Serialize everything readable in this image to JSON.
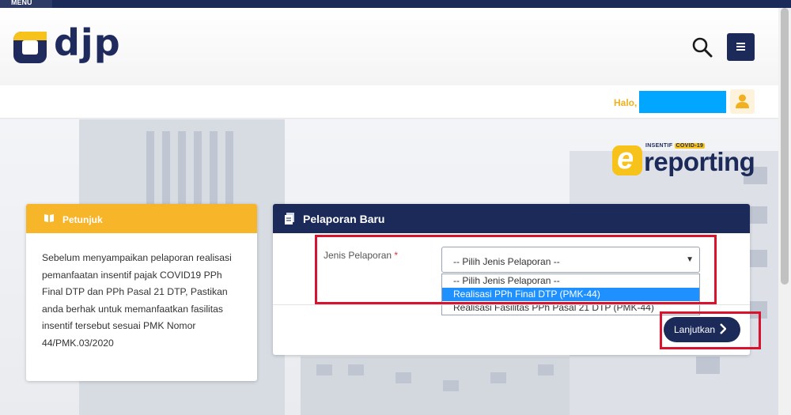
{
  "topbar": {
    "menu_label": "MENU"
  },
  "header": {
    "brand": "djp"
  },
  "userbar": {
    "greeting": "Halo,"
  },
  "ereporting": {
    "small_label": "INSENTIF",
    "badge": "COVID-19",
    "letter": "e",
    "word": "reporting"
  },
  "petunjuk": {
    "title": "Petunjuk",
    "body": "Sebelum menyampaikan pelaporan realisasi pemanfaatan insentif pajak COVID19 PPh Final DTP dan PPh Pasal 21 DTP, Pastikan anda berhak untuk memanfaatkan fasilitas insentif tersebut sesuai PMK Nomor 44/PMK.03/2020"
  },
  "pelaporan": {
    "title": "Pelaporan Baru",
    "field_label": "Jenis Pelaporan",
    "required_mark": "*",
    "selected_value": "-- Pilih Jenis Pelaporan --",
    "options": [
      "-- Pilih Jenis Pelaporan --",
      "Realisasi PPh Final DTP (PMK-44)",
      "Realisasi Fasilitas PPh Pasal 21 DTP (PMK-44)"
    ],
    "highlighted_option_index": 1,
    "next_button": "Lanjutkan"
  },
  "colors": {
    "navy": "#1c2a5a",
    "accent_yellow": "#f7b52a",
    "highlight_red": "#d7132d",
    "option_highlight": "#1e90ff"
  },
  "icons": [
    "search-icon",
    "hamburger-menu-icon",
    "user-icon",
    "book-icon",
    "document-icon",
    "chevron-right-icon",
    "caret-down-icon"
  ]
}
